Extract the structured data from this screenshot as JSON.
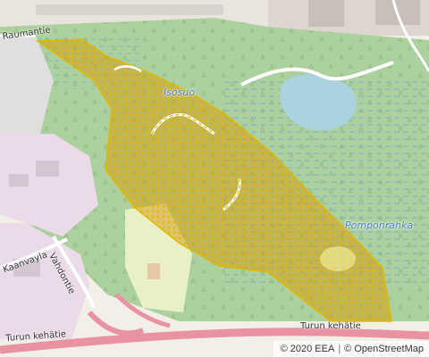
{
  "map": {
    "labels": {
      "isosuo": "Isosuo",
      "pomponrahka": "Pomponrahka",
      "vahdontie": "Vahdontie",
      "raumantie": "Raumantie",
      "kaanvayla": "Kaanvayla",
      "turun_kehatie_left": "Turun kehätie",
      "turun_kehatie_right": "Turun kehätie"
    },
    "colors": {
      "background": "#f2efe9",
      "forest": "#add19e",
      "wetland_hatch": "#6aa6d8",
      "residential": "#e0dfdf",
      "industrial": "#ebdbe8",
      "grass": "#e8f0c6",
      "water": "#aad3df",
      "motorway": "#e892a2",
      "overlay_fill": "#d4a017",
      "overlay_stroke": "#e1b800"
    }
  },
  "attribution": {
    "prefix": "© 2020 EEA",
    "separator": "|",
    "osm_link": "© OpenStreetMap"
  }
}
